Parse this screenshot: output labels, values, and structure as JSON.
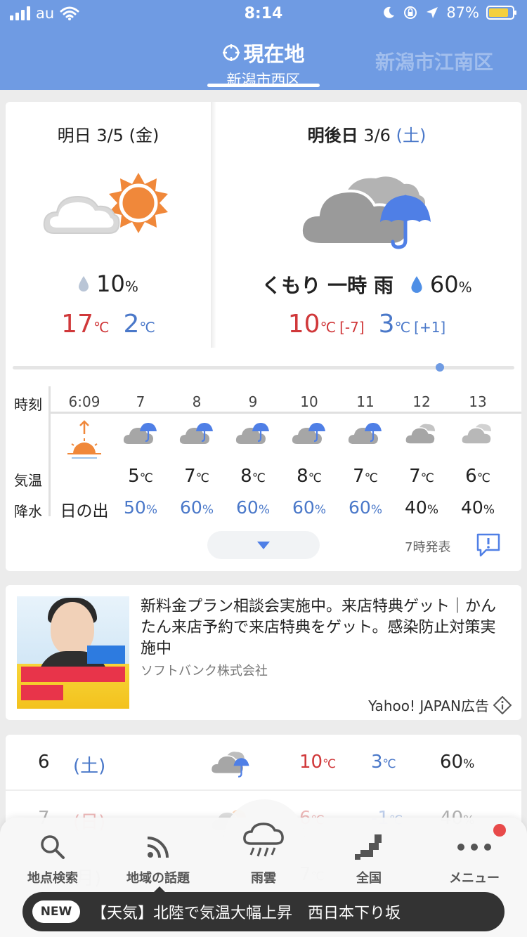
{
  "status_bar": {
    "carrier": "au",
    "time": "8:14",
    "battery": "87%"
  },
  "header": {
    "current_location_label": "現在地",
    "current_location_name": "新潟市西区",
    "next_location_name": "新潟市江南区"
  },
  "days": [
    {
      "label": "明日",
      "date": "3/5",
      "dow": "(金)",
      "weather": "",
      "pop": "10",
      "high": "17",
      "low": "2",
      "high_diff": "",
      "low_diff": ""
    },
    {
      "label": "明後日",
      "date": "3/6",
      "dow": "(土)",
      "weather": "くもり 一時 雨",
      "pop": "60",
      "high": "10",
      "low": "3",
      "high_diff": "[-7]",
      "low_diff": "[+1]"
    }
  ],
  "units": {
    "celsius": "℃",
    "percent": "%"
  },
  "hourly": {
    "labels": {
      "time": "時刻",
      "temp": "気温",
      "precip": "降水"
    },
    "hours": [
      {
        "time": "6:09",
        "icon": "sunrise-icon",
        "temp": "",
        "pop": "日の出"
      },
      {
        "time": "7",
        "icon": "cloud-umbrella-icon",
        "temp": "5",
        "pop": "50"
      },
      {
        "time": "8",
        "icon": "cloud-umbrella-icon",
        "temp": "7",
        "pop": "60"
      },
      {
        "time": "9",
        "icon": "cloud-umbrella-icon",
        "temp": "8",
        "pop": "60"
      },
      {
        "time": "10",
        "icon": "cloud-umbrella-icon",
        "temp": "8",
        "pop": "60"
      },
      {
        "time": "11",
        "icon": "cloud-umbrella-icon",
        "temp": "7",
        "pop": "60"
      },
      {
        "time": "12",
        "icon": "cloud-icon",
        "temp": "7",
        "pop": "40"
      },
      {
        "time": "13",
        "icon": "cloud-icon",
        "temp": "6",
        "pop": "40"
      }
    ],
    "issued": "7時発表"
  },
  "ad": {
    "text": "新料金プラン相談会実施中。来店特典ゲット｜かんたん来店予約で来店特典をゲット。感染防止対策実施中",
    "company": "ソフトバンク株式会社",
    "label": "Yahoo! JAPAN広告"
  },
  "weekly": [
    {
      "date": "6",
      "dow": "(土)",
      "high": "10",
      "low": "3",
      "pop": "60"
    },
    {
      "date": "7",
      "dow": "(日)",
      "high": "6",
      "low": "-1",
      "pop": "40"
    },
    {
      "date": "",
      "dow": "月)",
      "high": "7",
      "low": "",
      "pop": ""
    }
  ],
  "nav": [
    {
      "label": "地点検索",
      "icon": "search-icon"
    },
    {
      "label": "地域の話題",
      "icon": "rss-icon"
    },
    {
      "label": "雨雲",
      "icon": "rain-cloud-icon"
    },
    {
      "label": "全国",
      "icon": "japan-map-icon"
    },
    {
      "label": "メニュー",
      "icon": "more-icon"
    }
  ],
  "ticker": {
    "badge": "NEW",
    "text": "【天気】北陸で気温大幅上昇　西日本下り坂"
  },
  "colors": {
    "header_blue": "#6f9be3",
    "high_red": "#d0383a",
    "low_blue": "#4a78c9",
    "sun_orange": "#f0883a",
    "umbrella_blue": "#4f7fe6"
  }
}
